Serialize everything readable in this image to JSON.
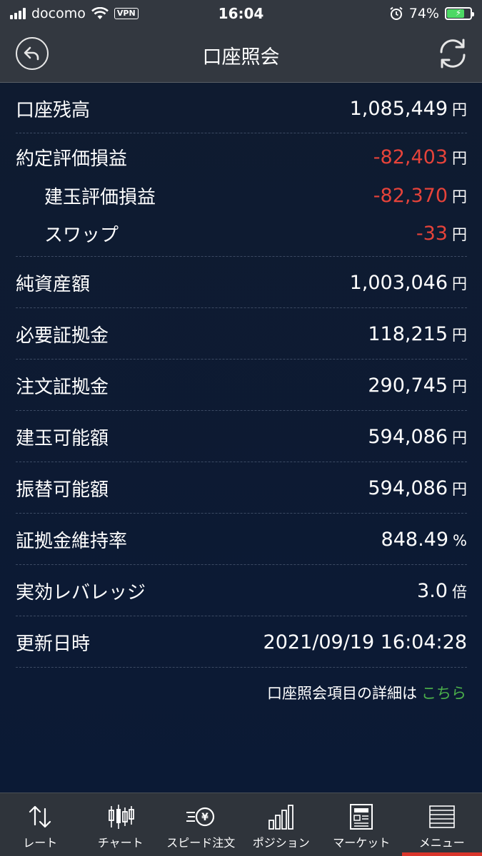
{
  "status_bar": {
    "carrier": "docomo",
    "vpn": "VPN",
    "time": "16:04",
    "battery": "74%",
    "battery_level": 0.74
  },
  "header": {
    "title": "口座照会"
  },
  "rows": [
    {
      "label": "口座残高",
      "value": "1,085,449",
      "unit": "円",
      "negative": false
    },
    {
      "label": "約定評価損益",
      "value": "-82,403",
      "unit": "円",
      "negative": true
    },
    {
      "label": "建玉評価損益",
      "value": "-82,370",
      "unit": "円",
      "negative": true
    },
    {
      "label": "スワップ",
      "value": "-33",
      "unit": "円",
      "negative": true
    },
    {
      "label": "純資産額",
      "value": "1,003,046",
      "unit": "円",
      "negative": false
    },
    {
      "label": "必要証拠金",
      "value": "118,215",
      "unit": "円",
      "negative": false
    },
    {
      "label": "注文証拠金",
      "value": "290,745",
      "unit": "円",
      "negative": false
    },
    {
      "label": "建玉可能額",
      "value": "594,086",
      "unit": "円",
      "negative": false
    },
    {
      "label": "振替可能額",
      "value": "594,086",
      "unit": "円",
      "negative": false
    },
    {
      "label": "証拠金維持率",
      "value": "848.49",
      "unit": "%",
      "negative": false
    },
    {
      "label": "実効レバレッジ",
      "value": "3.0",
      "unit": "倍",
      "negative": false
    },
    {
      "label": "更新日時",
      "value": "2021/09/19 16:04:28",
      "unit": "",
      "negative": false
    }
  ],
  "footnote": {
    "text": "口座照会項目の詳細は",
    "link": "こちら"
  },
  "tabs": [
    {
      "label": "レート",
      "icon": "rate-arrows-icon"
    },
    {
      "label": "チャート",
      "icon": "candlestick-icon"
    },
    {
      "label": "スピード注文",
      "icon": "speed-order-icon"
    },
    {
      "label": "ポジション",
      "icon": "position-bars-icon"
    },
    {
      "label": "マーケット",
      "icon": "market-news-icon"
    },
    {
      "label": "メニュー",
      "icon": "menu-list-icon"
    }
  ],
  "colors": {
    "negative": "#e6433a",
    "link": "#4cb04a",
    "active_tab": "#d9362b"
  }
}
